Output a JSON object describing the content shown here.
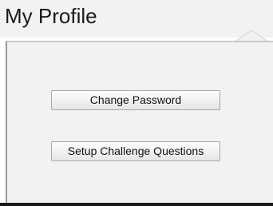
{
  "header": {
    "title": "My Profile"
  },
  "actions": {
    "change_password_label": "Change Password",
    "setup_challenge_label": "Setup Challenge Questions"
  },
  "colors": {
    "panel_background": "#f2f2f2",
    "header_background": "#f2f2f2",
    "bottom_bar": "#1a1a1a"
  },
  "icons": {
    "tab_notch": "up-caret-notch-icon"
  }
}
